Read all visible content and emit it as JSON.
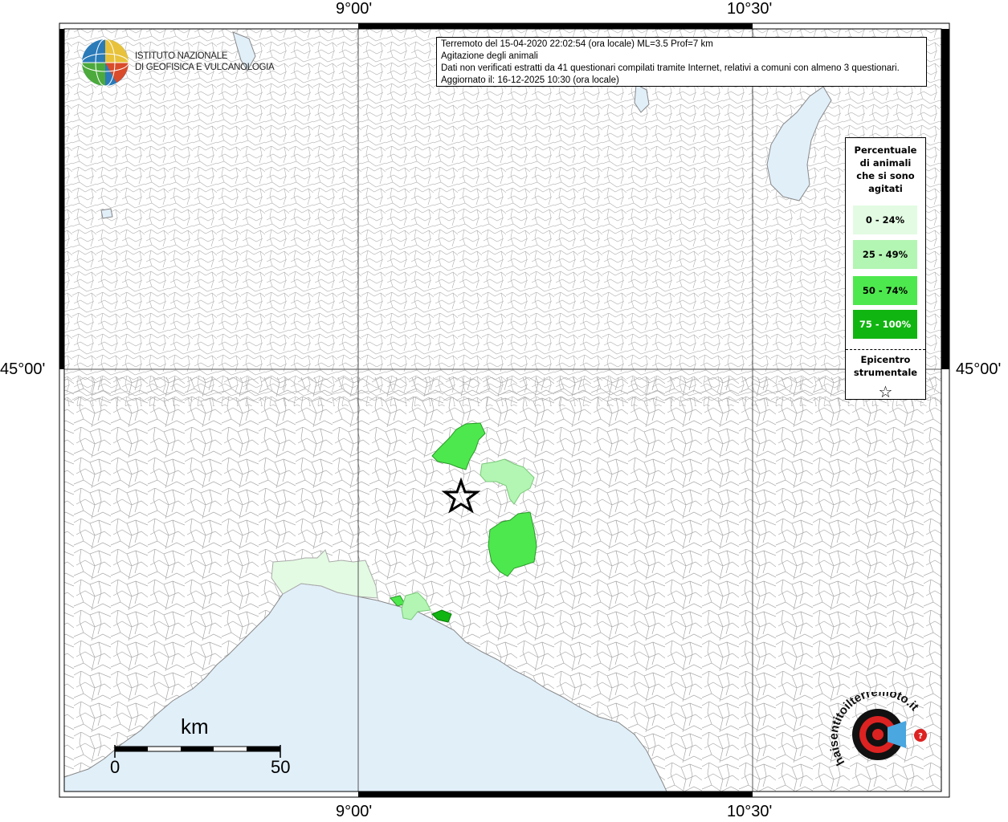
{
  "coords": {
    "top": [
      "9°00'",
      "10°30'"
    ],
    "bottom": [
      "9°00'",
      "10°30'"
    ],
    "left": "45°00'",
    "right": "45°00'"
  },
  "logo": {
    "line1": "ISTITUTO NAZIONALE",
    "line2": "DI GEOFISICA E VULCANOLOGIA"
  },
  "info": {
    "line1": "Terremoto del 15-04-2020 22:02:54 (ora locale) ML=3.5 Prof=7 km",
    "line2": "Agitazione degli animali",
    "line3": "Dati non verificati estratti da 41 questionari compilati tramite Internet, relativi a comuni con almeno 3 questionari.",
    "line4": "Aggiornato il: 16-12-2025 10:30 (ora locale)"
  },
  "legend": {
    "title_lines": [
      "Percentuale",
      "di animali",
      "che si sono",
      "agitati"
    ],
    "items": [
      {
        "label": "0 - 24%",
        "color": "#e3fbe3",
        "text_color": "#000"
      },
      {
        "label": "25 - 49%",
        "color": "#b3f5b3",
        "text_color": "#000"
      },
      {
        "label": "50 - 74%",
        "color": "#4de84d",
        "text_color": "#000"
      },
      {
        "label": "75 - 100%",
        "color": "#11b511",
        "text_color": "#fff"
      }
    ],
    "epicenter_lines": [
      "Epicentro",
      "strumentale"
    ],
    "epicenter_symbol": "☆"
  },
  "scale": {
    "unit": "km",
    "min": "0",
    "max": "50"
  },
  "colors": {
    "sea": "#e1eff9",
    "border": "#999999",
    "frame": "#000000"
  },
  "watermark": {
    "text": "haisentitoilterremoto.it",
    "url": "www."
  }
}
